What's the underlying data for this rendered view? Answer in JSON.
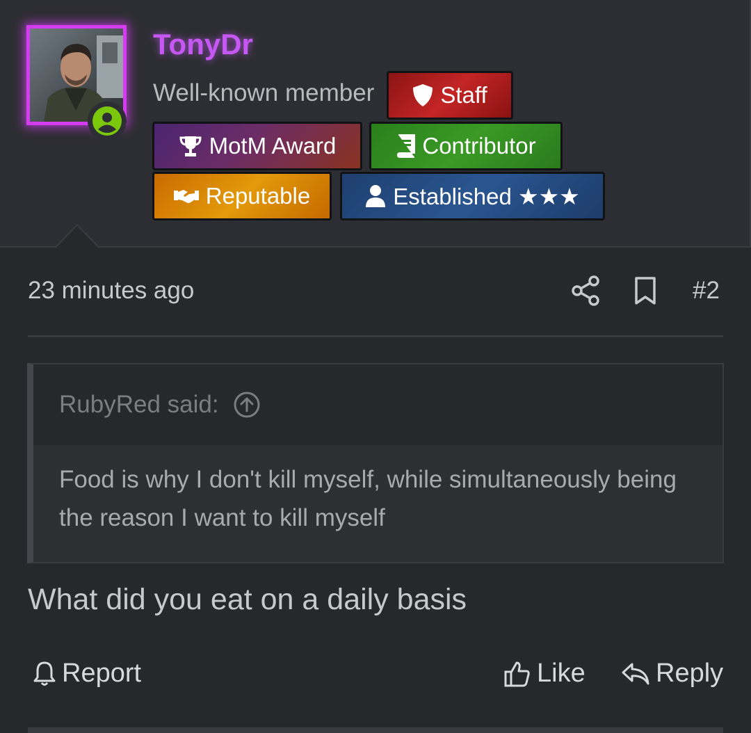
{
  "user": {
    "username": "TonyDr",
    "title": "Well-known member",
    "avatar_icon": "avatar-photo",
    "status_icon": "user-circle-icon",
    "status_color": "#7ac70c",
    "name_color": "#c558f2"
  },
  "badges": [
    {
      "label": "Staff",
      "icon": "shield-icon",
      "color": "#b01c1c"
    },
    {
      "label": "MotM Award",
      "icon": "trophy-icon",
      "color": "#5a2a6e"
    },
    {
      "label": "Contributor",
      "icon": "book-icon",
      "color": "#2f8a20"
    },
    {
      "label": "Reputable",
      "icon": "handshake-icon",
      "color": "#d9890a"
    },
    {
      "label": "Established ★★★",
      "icon": "user-icon",
      "color": "#244a80"
    }
  ],
  "post": {
    "timestamp": "23 minutes ago",
    "number": "#2",
    "body": "What did you eat on a daily basis"
  },
  "quote": {
    "author": "RubyRed said:",
    "text": "Food is why I don't kill myself, while simultaneously being the reason I want to kill myself"
  },
  "actions": {
    "report": "Report",
    "like": "Like",
    "reply": "Reply"
  }
}
